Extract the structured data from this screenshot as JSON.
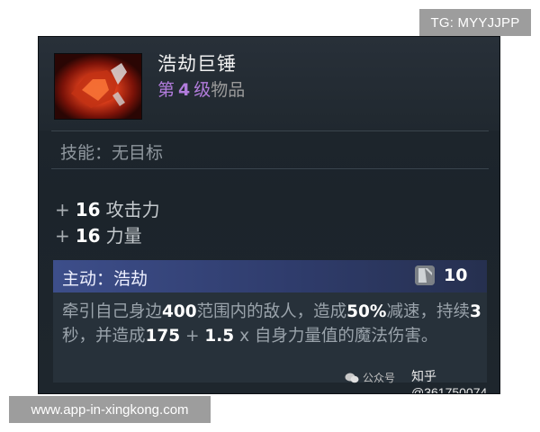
{
  "overlay": {
    "top_right_tag": "TG: MYYJJPP",
    "bottom_left_tag": "www.app-in-xingkong.com"
  },
  "item": {
    "name": "浩劫巨锤",
    "icon": "hammer-item-icon",
    "tier_prefix": "第",
    "tier_number": "4",
    "tier_suffix": "级",
    "tier_category": "物品",
    "skill_line": "技能：无目标"
  },
  "stats": [
    {
      "sign": "+",
      "value": "16",
      "label": "攻击力"
    },
    {
      "sign": "+",
      "value": "16",
      "label": "力量"
    }
  ],
  "active": {
    "title": "主动：浩劫",
    "cooldown_icon": "cooldown-icon",
    "cooldown": "10",
    "desc": {
      "t1": "牵引自己身边",
      "n1": "400",
      "t2": "范围内的敌人，造成",
      "n2": "50%",
      "t3": "减速，持续",
      "n3": "3",
      "t4": "秒，并造成",
      "n4": "175",
      "t5": " + ",
      "n5": "1.5",
      "t6": " x 自身力量值的魔法伤害。"
    }
  },
  "watermarks": {
    "wechat": "公众号",
    "zhihu": "知乎 @361750074"
  },
  "colors": {
    "tier_purple": "#b27cdc",
    "panel_bg": "#1e262d",
    "active_bar": "#3d4e8a"
  }
}
